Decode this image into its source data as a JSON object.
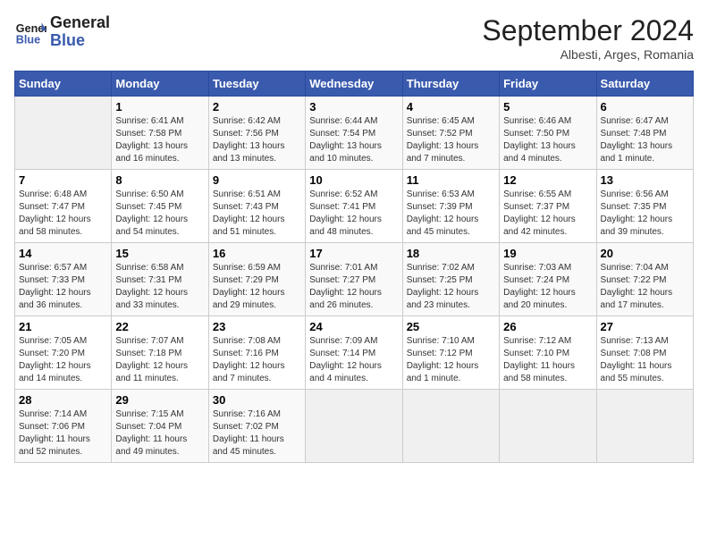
{
  "header": {
    "logo_line1": "General",
    "logo_line2": "Blue",
    "month_title": "September 2024",
    "subtitle": "Albesti, Arges, Romania"
  },
  "weekdays": [
    "Sunday",
    "Monday",
    "Tuesday",
    "Wednesday",
    "Thursday",
    "Friday",
    "Saturday"
  ],
  "days": [
    {
      "num": "",
      "info": ""
    },
    {
      "num": "1",
      "info": "Sunrise: 6:41 AM\nSunset: 7:58 PM\nDaylight: 13 hours\nand 16 minutes."
    },
    {
      "num": "2",
      "info": "Sunrise: 6:42 AM\nSunset: 7:56 PM\nDaylight: 13 hours\nand 13 minutes."
    },
    {
      "num": "3",
      "info": "Sunrise: 6:44 AM\nSunset: 7:54 PM\nDaylight: 13 hours\nand 10 minutes."
    },
    {
      "num": "4",
      "info": "Sunrise: 6:45 AM\nSunset: 7:52 PM\nDaylight: 13 hours\nand 7 minutes."
    },
    {
      "num": "5",
      "info": "Sunrise: 6:46 AM\nSunset: 7:50 PM\nDaylight: 13 hours\nand 4 minutes."
    },
    {
      "num": "6",
      "info": "Sunrise: 6:47 AM\nSunset: 7:48 PM\nDaylight: 13 hours\nand 1 minute."
    },
    {
      "num": "7",
      "info": "Sunrise: 6:48 AM\nSunset: 7:47 PM\nDaylight: 12 hours\nand 58 minutes."
    },
    {
      "num": "8",
      "info": "Sunrise: 6:50 AM\nSunset: 7:45 PM\nDaylight: 12 hours\nand 54 minutes."
    },
    {
      "num": "9",
      "info": "Sunrise: 6:51 AM\nSunset: 7:43 PM\nDaylight: 12 hours\nand 51 minutes."
    },
    {
      "num": "10",
      "info": "Sunrise: 6:52 AM\nSunset: 7:41 PM\nDaylight: 12 hours\nand 48 minutes."
    },
    {
      "num": "11",
      "info": "Sunrise: 6:53 AM\nSunset: 7:39 PM\nDaylight: 12 hours\nand 45 minutes."
    },
    {
      "num": "12",
      "info": "Sunrise: 6:55 AM\nSunset: 7:37 PM\nDaylight: 12 hours\nand 42 minutes."
    },
    {
      "num": "13",
      "info": "Sunrise: 6:56 AM\nSunset: 7:35 PM\nDaylight: 12 hours\nand 39 minutes."
    },
    {
      "num": "14",
      "info": "Sunrise: 6:57 AM\nSunset: 7:33 PM\nDaylight: 12 hours\nand 36 minutes."
    },
    {
      "num": "15",
      "info": "Sunrise: 6:58 AM\nSunset: 7:31 PM\nDaylight: 12 hours\nand 33 minutes."
    },
    {
      "num": "16",
      "info": "Sunrise: 6:59 AM\nSunset: 7:29 PM\nDaylight: 12 hours\nand 29 minutes."
    },
    {
      "num": "17",
      "info": "Sunrise: 7:01 AM\nSunset: 7:27 PM\nDaylight: 12 hours\nand 26 minutes."
    },
    {
      "num": "18",
      "info": "Sunrise: 7:02 AM\nSunset: 7:25 PM\nDaylight: 12 hours\nand 23 minutes."
    },
    {
      "num": "19",
      "info": "Sunrise: 7:03 AM\nSunset: 7:24 PM\nDaylight: 12 hours\nand 20 minutes."
    },
    {
      "num": "20",
      "info": "Sunrise: 7:04 AM\nSunset: 7:22 PM\nDaylight: 12 hours\nand 17 minutes."
    },
    {
      "num": "21",
      "info": "Sunrise: 7:05 AM\nSunset: 7:20 PM\nDaylight: 12 hours\nand 14 minutes."
    },
    {
      "num": "22",
      "info": "Sunrise: 7:07 AM\nSunset: 7:18 PM\nDaylight: 12 hours\nand 11 minutes."
    },
    {
      "num": "23",
      "info": "Sunrise: 7:08 AM\nSunset: 7:16 PM\nDaylight: 12 hours\nand 7 minutes."
    },
    {
      "num": "24",
      "info": "Sunrise: 7:09 AM\nSunset: 7:14 PM\nDaylight: 12 hours\nand 4 minutes."
    },
    {
      "num": "25",
      "info": "Sunrise: 7:10 AM\nSunset: 7:12 PM\nDaylight: 12 hours\nand 1 minute."
    },
    {
      "num": "26",
      "info": "Sunrise: 7:12 AM\nSunset: 7:10 PM\nDaylight: 11 hours\nand 58 minutes."
    },
    {
      "num": "27",
      "info": "Sunrise: 7:13 AM\nSunset: 7:08 PM\nDaylight: 11 hours\nand 55 minutes."
    },
    {
      "num": "28",
      "info": "Sunrise: 7:14 AM\nSunset: 7:06 PM\nDaylight: 11 hours\nand 52 minutes."
    },
    {
      "num": "29",
      "info": "Sunrise: 7:15 AM\nSunset: 7:04 PM\nDaylight: 11 hours\nand 49 minutes."
    },
    {
      "num": "30",
      "info": "Sunrise: 7:16 AM\nSunset: 7:02 PM\nDaylight: 11 hours\nand 45 minutes."
    },
    {
      "num": "",
      "info": ""
    },
    {
      "num": "",
      "info": ""
    },
    {
      "num": "",
      "info": ""
    },
    {
      "num": "",
      "info": ""
    }
  ]
}
